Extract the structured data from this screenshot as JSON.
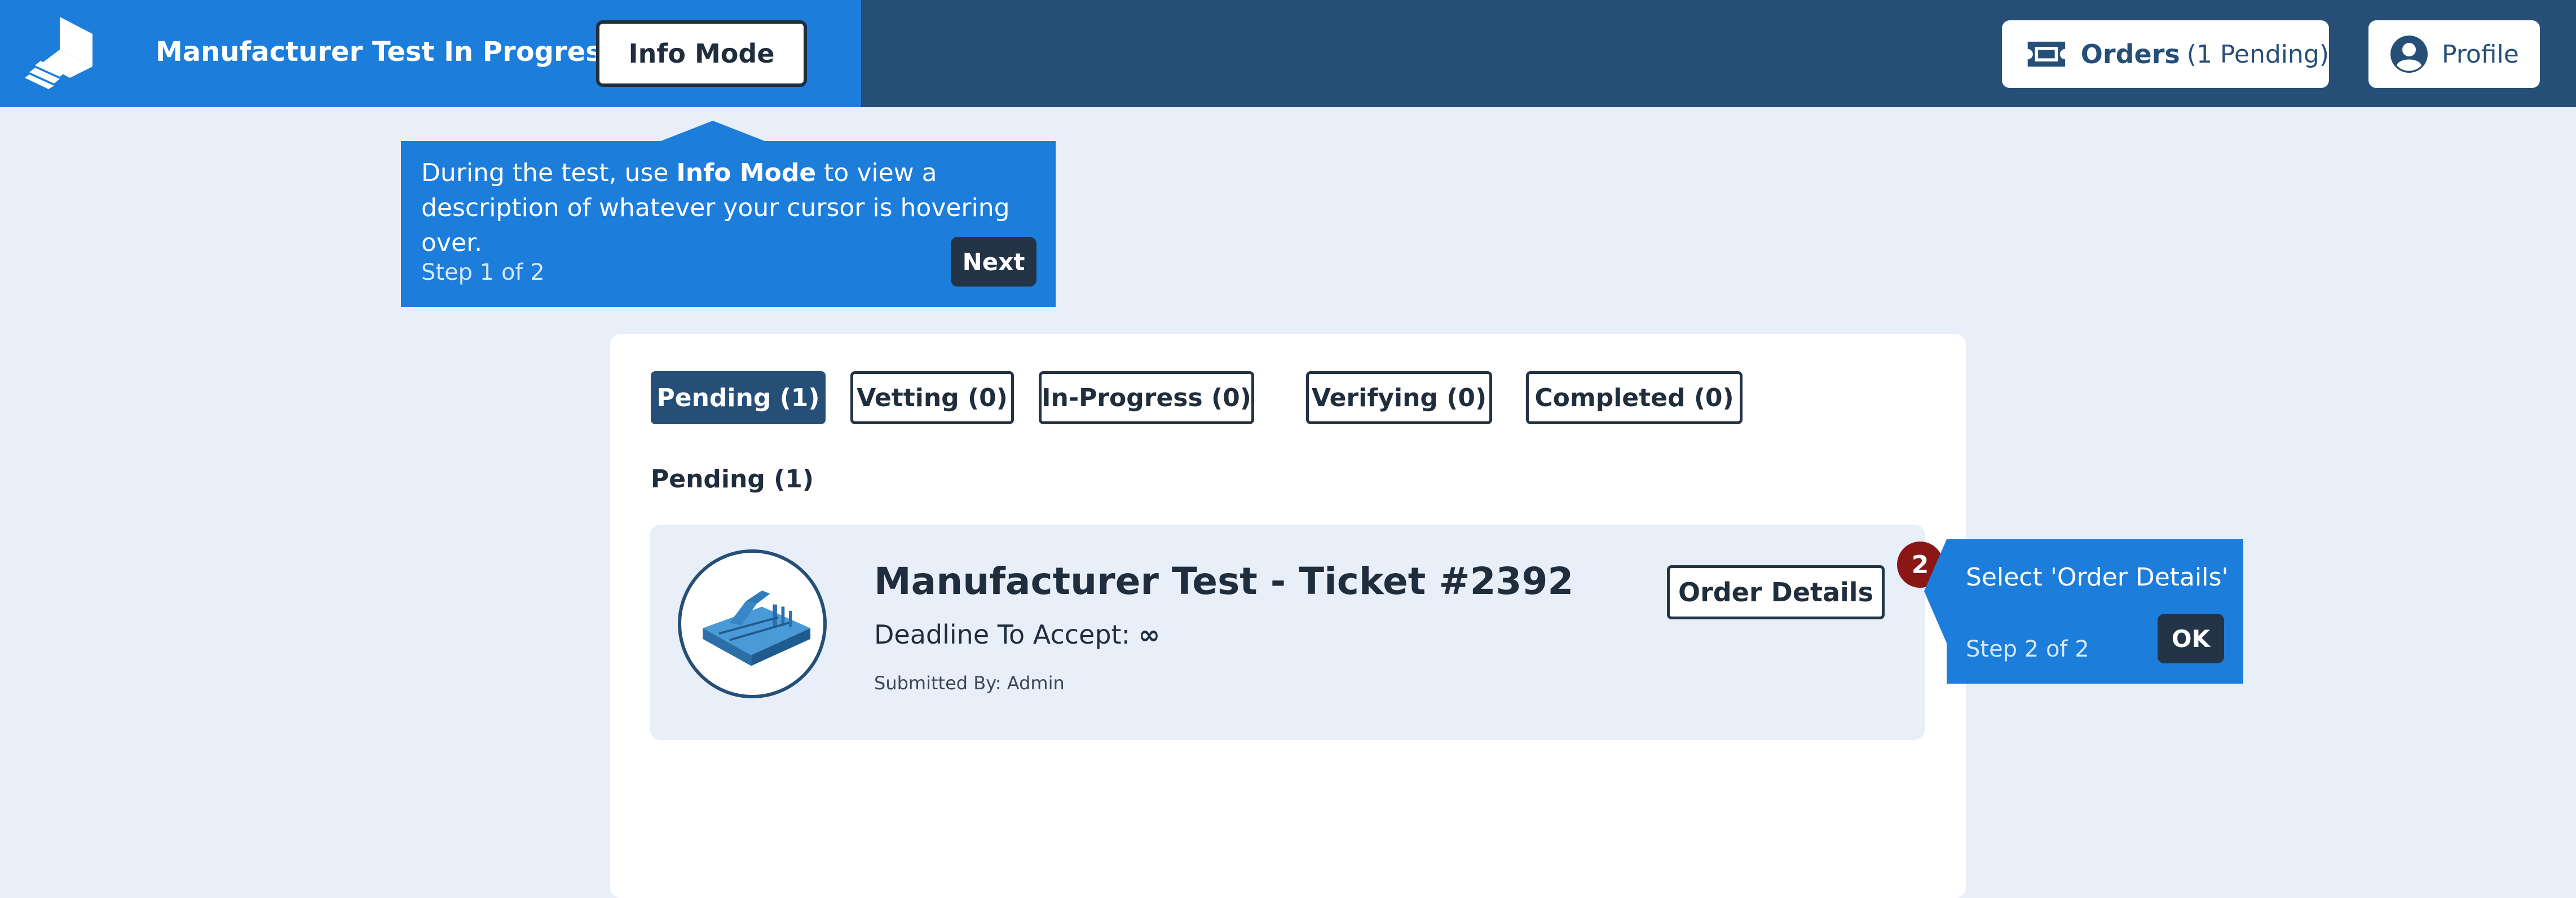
{
  "header": {
    "title": "Manufacturer Test In Progress",
    "info_mode_label": "Info Mode",
    "orders_label": "Orders",
    "orders_pending": "(1 Pending)",
    "profile_label": "Profile",
    "icons": [
      "logo-icon",
      "ticket-icon",
      "user-circle-icon"
    ]
  },
  "tooltip_info": {
    "text_before": "During the test, use ",
    "text_bold": "Info Mode",
    "text_after": " to view a description of whatever your cursor is hovering over.",
    "step": "Step 1 of 2",
    "next_label": "Next"
  },
  "tabs": [
    {
      "label": "Pending (1)",
      "active": true
    },
    {
      "label": "Vetting (0)",
      "active": false
    },
    {
      "label": "In-Progress (0)",
      "active": false
    },
    {
      "label": "Verifying (0)",
      "active": false
    },
    {
      "label": "Completed (0)",
      "active": false
    }
  ],
  "section": {
    "title": "Pending (1)"
  },
  "order_card": {
    "title": "Manufacturer Test - Ticket #2392",
    "deadline_label": "Deadline To Accept:",
    "deadline_value": "∞",
    "submitted_by": "Submitted By: Admin",
    "details_label": "Order Details",
    "badge": "2"
  },
  "tooltip_order": {
    "text": "Select 'Order Details'",
    "step": "Step 2 of 2",
    "ok_label": "OK"
  },
  "colors": {
    "header_dark": "#264f77",
    "header_accent": "#1c7ddb",
    "background": "#e9eff8",
    "badge": "#8b1616",
    "button_dark": "#243447"
  }
}
